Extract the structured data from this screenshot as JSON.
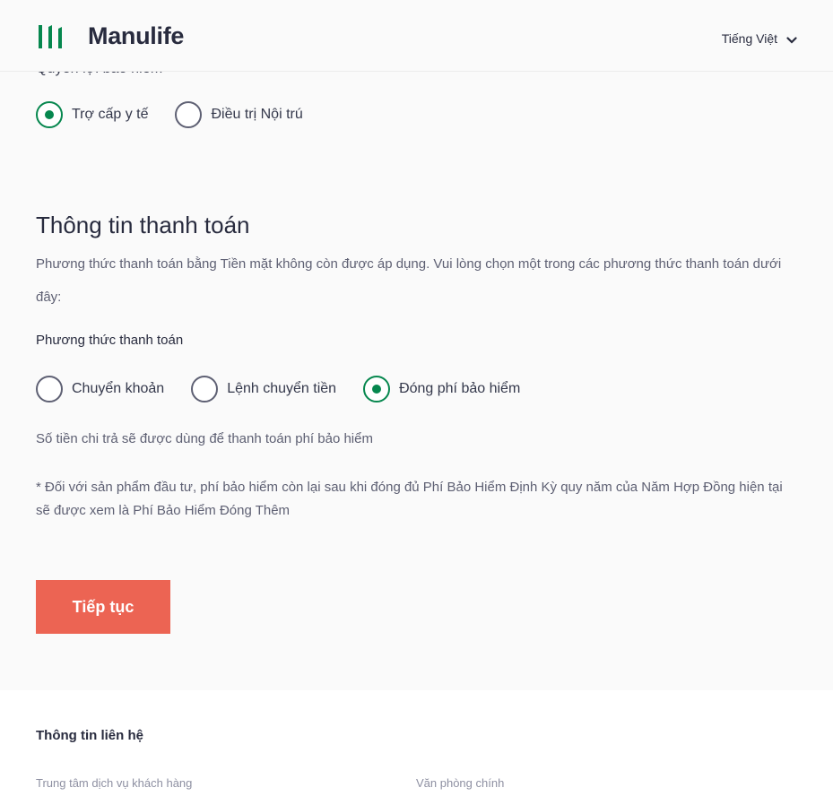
{
  "header": {
    "brand": "Manulife",
    "language": "Tiếng Việt",
    "brand_color": "#06874e"
  },
  "benefit": {
    "label": "Quyền lợi bảo hiểm",
    "options": [
      {
        "label": "Trợ cấp y tế",
        "checked": true
      },
      {
        "label": "Điều trị Nội trú",
        "checked": false
      }
    ]
  },
  "payment": {
    "title": "Thông tin thanh toán",
    "description": "Phương thức thanh toán bằng Tiền mặt không còn được áp dụng. Vui lòng chọn một trong các phương thức thanh toán dưới đây:",
    "method_label": "Phương thức thanh toán",
    "options": [
      {
        "label": "Chuyển khoản",
        "checked": false
      },
      {
        "label": "Lệnh chuyển tiền",
        "checked": false
      },
      {
        "label": "Đóng phí bảo hiểm",
        "checked": true
      }
    ],
    "info": "Số tiền chi trả sẽ được dùng để thanh toán phí bảo hiểm",
    "note": "* Đối với sản phẩm đầu tư, phí bảo hiểm còn lại sau khi đóng đủ Phí Bảo Hiểm Định Kỳ quy năm của Năm Hợp Đồng hiện tại sẽ được xem là Phí Bảo Hiểm Đóng Thêm"
  },
  "actions": {
    "continue_label": "Tiếp tục",
    "button_color": "#ec6453"
  },
  "footer": {
    "title": "Thông tin liên hệ",
    "col1": "Trung tâm dịch vụ khách hàng",
    "col2": "Văn phòng chính"
  }
}
